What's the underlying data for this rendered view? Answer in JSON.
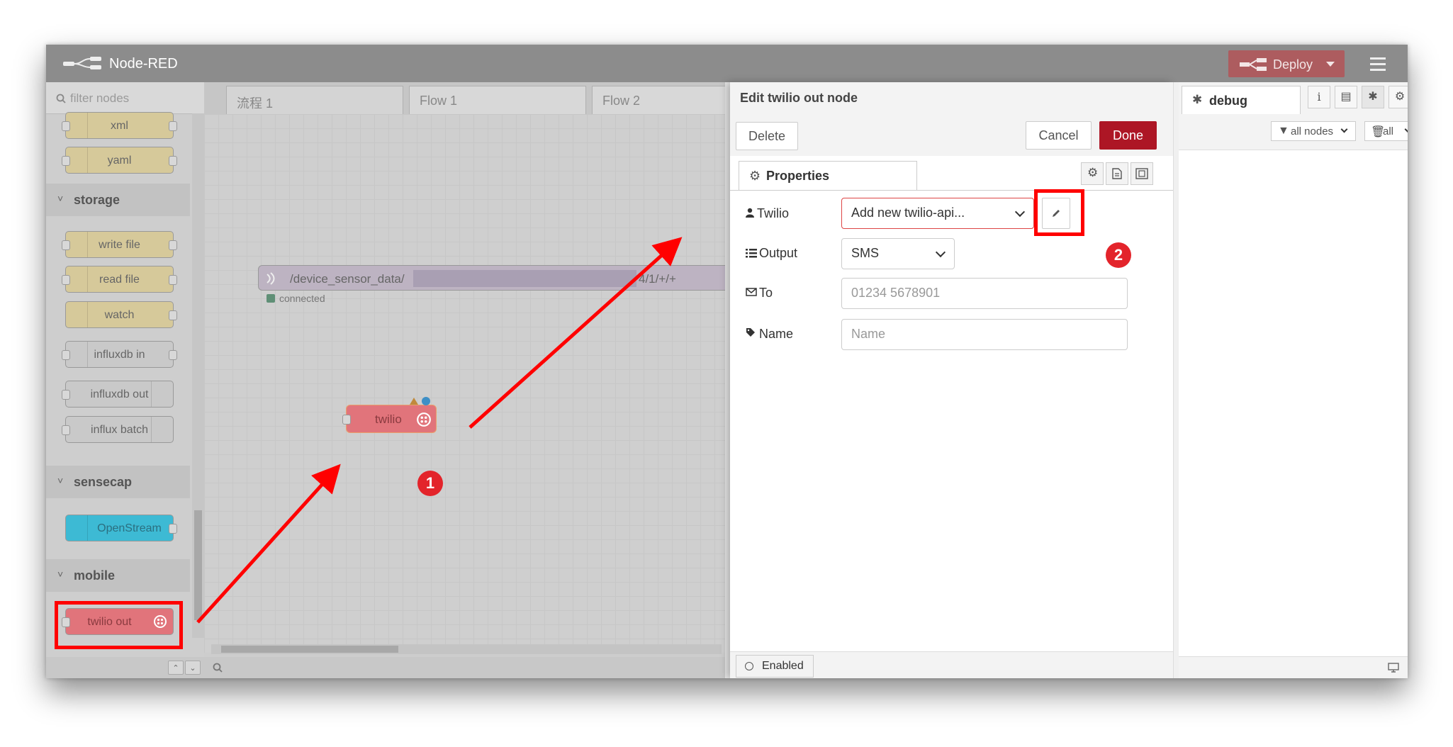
{
  "app": {
    "title": "Node-RED",
    "deploy_label": "Deploy"
  },
  "palette": {
    "filter_placeholder": "filter nodes",
    "nodes_top": [
      {
        "label": "xml"
      },
      {
        "label": "yaml"
      }
    ],
    "categories": {
      "storage": "storage",
      "sensecap": "sensecap",
      "mobile": "mobile"
    },
    "storage_nodes": [
      {
        "label": "write file"
      },
      {
        "label": "read file"
      },
      {
        "label": "watch"
      },
      {
        "label": "influxdb in"
      },
      {
        "label": "influxdb out"
      },
      {
        "label": "influx batch"
      }
    ],
    "sensecap_nodes": [
      {
        "label": "OpenStream"
      }
    ],
    "mobile_nodes": [
      {
        "label": "twilio out"
      }
    ]
  },
  "workspace": {
    "tabs": [
      {
        "label": "流程 1"
      },
      {
        "label": "Flow 1"
      },
      {
        "label": "Flow 2"
      }
    ],
    "mqtt_node": {
      "topic_left": "/device_sensor_data/",
      "topic_right": "4/1/+/+",
      "status": "connected"
    },
    "twilio_node": {
      "label": "twilio"
    }
  },
  "tray": {
    "title": "Edit twilio out node",
    "delete_label": "Delete",
    "cancel_label": "Cancel",
    "done_label": "Done",
    "properties_tab": "Properties",
    "fields": {
      "twilio": {
        "label": "Twilio",
        "value": "Add new twilio-api..."
      },
      "output": {
        "label": "Output",
        "value": "SMS"
      },
      "to": {
        "label": "To",
        "placeholder": "01234 5678901"
      },
      "name": {
        "label": "Name",
        "placeholder": "Name"
      }
    },
    "enabled_label": "Enabled"
  },
  "sidebar": {
    "tab_label": "debug",
    "filter_all_nodes": "all nodes",
    "filter_all": "all"
  },
  "annotations": {
    "badge1": "1",
    "badge2": "2"
  },
  "colors": {
    "highlight": "#ff0000",
    "done_button": "#ad1625",
    "twilio_node": "#e1747b",
    "openstream_node": "#3dbad4"
  }
}
